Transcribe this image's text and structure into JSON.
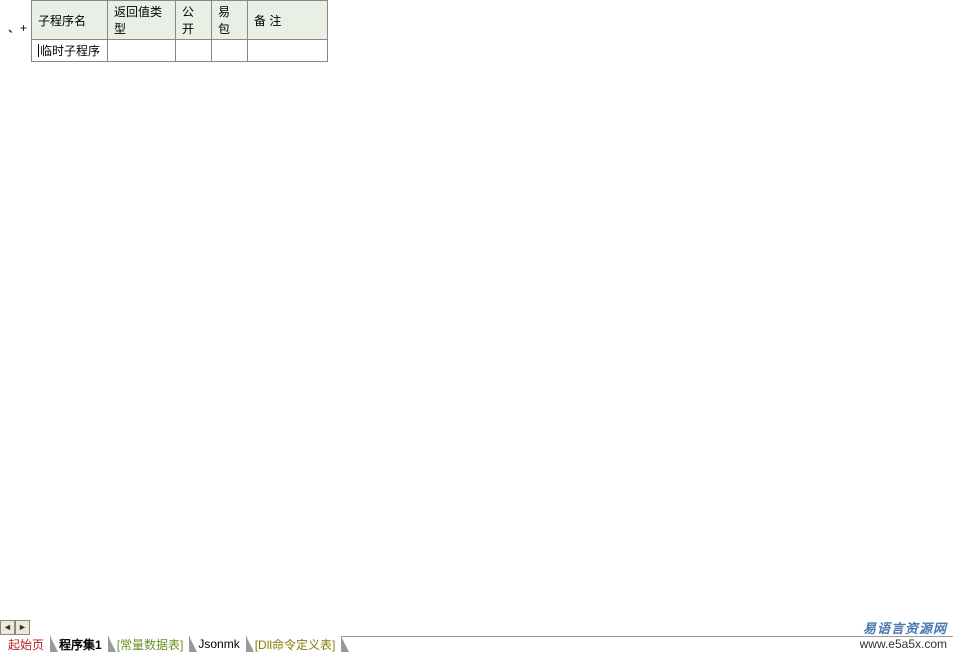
{
  "table": {
    "headers": {
      "name": "子程序名",
      "return_type": "返回值类型",
      "public": "公开",
      "easy_pkg": "易包",
      "remark": "备 注"
    },
    "rows": [
      {
        "name": "临时子程序",
        "return_type": "",
        "public": "",
        "easy_pkg": "",
        "remark": ""
      }
    ],
    "row_prefix_symbol": "、+"
  },
  "scroll": {
    "left_symbol": "◄",
    "right_symbol": "►"
  },
  "tabs": [
    {
      "label": "起始页",
      "style": "red",
      "active": false
    },
    {
      "label": "程序集1",
      "style": "black",
      "active": true
    },
    {
      "label": "[常量数据表]",
      "style": "green",
      "active": false
    },
    {
      "label": "Jsonmk",
      "style": "black",
      "active": false
    },
    {
      "label": "[Dll命令定义表]",
      "style": "olive",
      "active": false
    }
  ],
  "watermark": {
    "title": "易语言资源网",
    "url": "www.e5a5x.com"
  }
}
